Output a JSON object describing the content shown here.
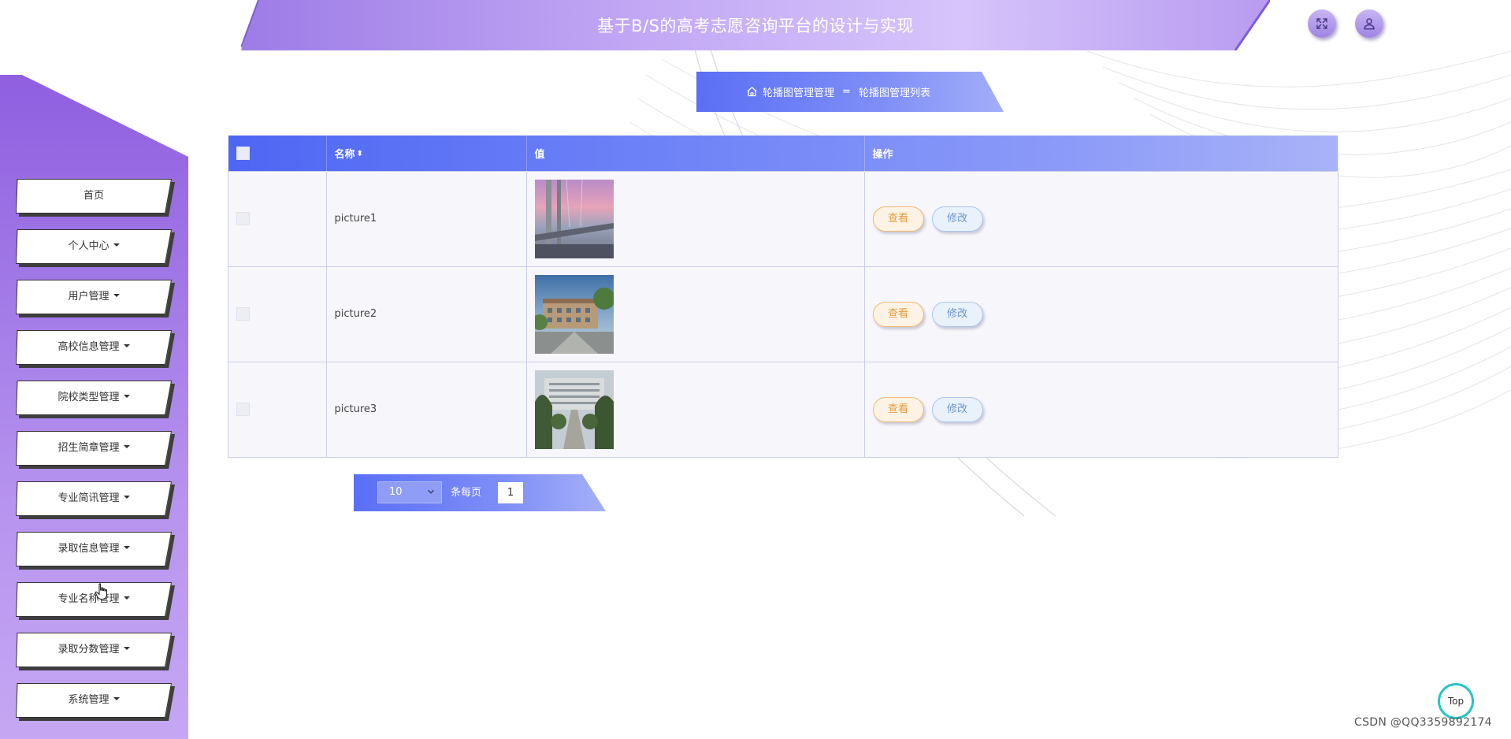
{
  "header": {
    "title": "基于B/S的高考志愿咨询平台的设计与实现",
    "fullscreen_icon": "expand-icon",
    "user_icon": "user-icon"
  },
  "sidebar": {
    "items": [
      {
        "label": "首页",
        "has_caret": false
      },
      {
        "label": "个人中心",
        "has_caret": true
      },
      {
        "label": "用户管理",
        "has_caret": true
      },
      {
        "label": "高校信息管理",
        "has_caret": true
      },
      {
        "label": "院校类型管理",
        "has_caret": true
      },
      {
        "label": "招生简章管理",
        "has_caret": true
      },
      {
        "label": "专业简讯管理",
        "has_caret": true
      },
      {
        "label": "录取信息管理",
        "has_caret": true
      },
      {
        "label": "专业名称管理",
        "has_caret": true
      },
      {
        "label": "录取分数管理",
        "has_caret": true
      },
      {
        "label": "系统管理",
        "has_caret": true
      }
    ]
  },
  "breadcrumb": {
    "icon": "home-icon",
    "first": "轮播图管理管理",
    "separator": "=",
    "second": "轮播图管理列表"
  },
  "table": {
    "columns": [
      "名称",
      "值",
      "操作"
    ],
    "sort_icon": "⬍",
    "rows": [
      {
        "name": "picture1",
        "view": "查看",
        "edit": "修改"
      },
      {
        "name": "picture2",
        "view": "查看",
        "edit": "修改"
      },
      {
        "name": "picture3",
        "view": "查看",
        "edit": "修改"
      }
    ]
  },
  "pagination": {
    "page_size": "10",
    "per_page_label": "条每页",
    "current_page": "1"
  },
  "top_button": {
    "label": "Top"
  },
  "watermark": "CSDN @QQ3359892174",
  "colors": {
    "accent_blue": "#5a6ff5",
    "sidebar_purple": "#9d6ee2",
    "view_orange": "#e59b3e",
    "edit_blue": "#6b96cc",
    "top_teal": "#26c6c2"
  }
}
